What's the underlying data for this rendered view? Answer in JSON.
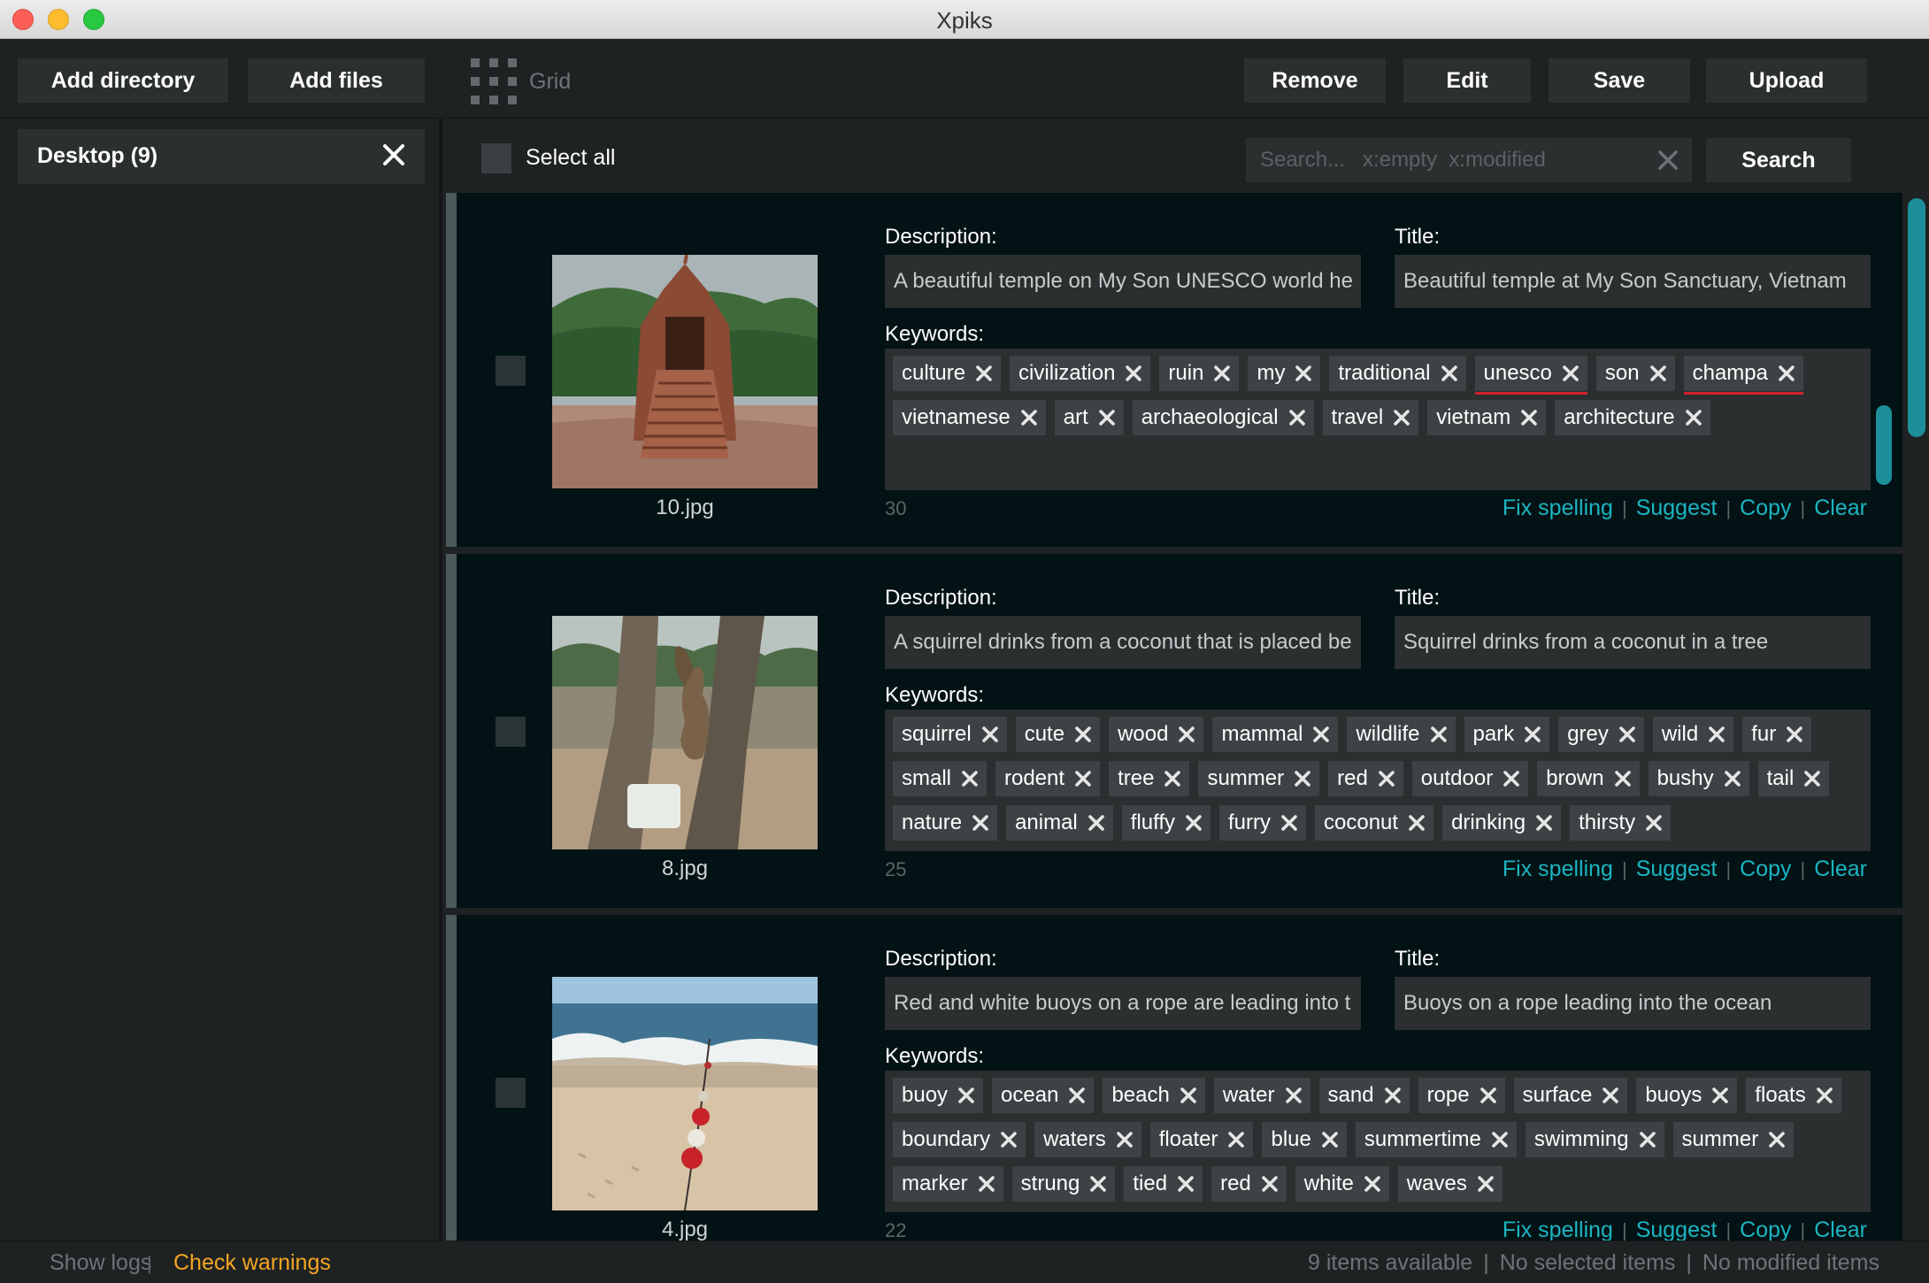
{
  "window": {
    "title": "Xpiks"
  },
  "toolbar": {
    "add_directory": "Add directory",
    "add_files": "Add files",
    "grid_label": "Grid",
    "remove": "Remove",
    "edit": "Edit",
    "save": "Save",
    "upload": "Upload"
  },
  "sidebar": {
    "directories": [
      {
        "label": "Desktop (9)"
      }
    ]
  },
  "filter": {
    "select_all": "Select all",
    "search_placeholder": "Search...   x:empty  x:modified",
    "search_button": "Search"
  },
  "labels": {
    "description": "Description:",
    "title": "Title:",
    "keywords": "Keywords:",
    "fix_spelling": "Fix spelling",
    "suggest": "Suggest",
    "copy": "Copy",
    "clear": "Clear",
    "sep": "|"
  },
  "items": [
    {
      "filename": "10.jpg",
      "description": "A beautiful temple on My Son UNESCO world he",
      "title": "Beautiful temple at My Son Sanctuary, Vietnam",
      "keyword_count": "30",
      "keywords": [
        "culture",
        "civilization",
        "ruin",
        "my",
        "traditional",
        "unesco",
        "son",
        "champa",
        "vietnamese",
        "art",
        "archaeological",
        "travel",
        "vietnam",
        "architecture"
      ],
      "misspelled": [
        "unesco",
        "champa"
      ]
    },
    {
      "filename": "8.jpg",
      "description": "A squirrel drinks from a coconut that is placed be",
      "title": "Squirrel drinks from a coconut in a tree",
      "keyword_count": "25",
      "keywords": [
        "squirrel",
        "cute",
        "wood",
        "mammal",
        "wildlife",
        "park",
        "grey",
        "wild",
        "fur",
        "small",
        "rodent",
        "tree",
        "summer",
        "red",
        "outdoor",
        "brown",
        "bushy",
        "tail",
        "nature",
        "animal",
        "fluffy",
        "furry",
        "coconut",
        "drinking",
        "thirsty"
      ],
      "misspelled": []
    },
    {
      "filename": "4.jpg",
      "description": "Red and white buoys on a rope are leading into t",
      "title": "Buoys on a rope leading into the ocean",
      "keyword_count": "22",
      "keywords": [
        "buoy",
        "ocean",
        "beach",
        "water",
        "sand",
        "rope",
        "surface",
        "buoys",
        "floats",
        "boundary",
        "waters",
        "floater",
        "blue",
        "summertime",
        "swimming",
        "summer",
        "marker",
        "strung",
        "tied",
        "red",
        "white",
        "waves"
      ],
      "misspelled": []
    }
  ],
  "status": {
    "show_logs": "Show logs",
    "check_warnings": "Check warnings",
    "items_available": "9 items available",
    "selected": "No selected items",
    "modified": "No modified items",
    "sep": "|"
  },
  "colors": {
    "accent": "#1bb5c2",
    "warning": "#f5a623",
    "misspelled": "#d0212c"
  }
}
